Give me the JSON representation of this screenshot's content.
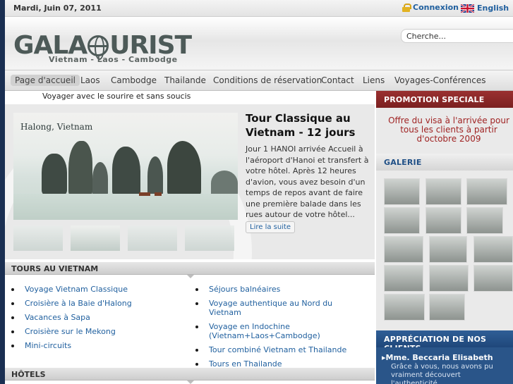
{
  "topbar": {
    "date": "Mardi, Juin 07, 2011",
    "login_label": "Connexion",
    "language_label": "English"
  },
  "header": {
    "logo_text_left": "GALA",
    "logo_text_right": "URIST",
    "tagline": "Vietnam - Laos - Cambodge",
    "search_placeholder": "Cherche..."
  },
  "nav": {
    "items": [
      "Page d'accueil",
      "Laos",
      "Cambodge",
      "Thailande",
      "Conditions de réservation",
      "Contact",
      "Liens",
      "Voyages-Conférences"
    ]
  },
  "slogan": "Voyager avec le sourire et sans soucis",
  "feature": {
    "photo_caption": "Halong, Vietnam",
    "title": "Tour Classique au Vietnam - 12 jours",
    "text": "Jour 1   HANOI arrivée Accueil à l'aéroport d'Hanoi et transfert à votre hôtel. Après 12 heures d'avion, vous avez besoin d'un temps de repos avant de faire une première balade dans les rues autour de votre hôtel...",
    "read_more": "Lire la suite"
  },
  "tours": {
    "heading": "TOURS AU VIETNAM",
    "left": [
      "Voyage Vietnam Classique",
      "Croisière à la Baie d'Halong",
      "Vacances à Sapa",
      "Croisière sur le Mekong",
      "Mini-circuits"
    ],
    "right": [
      "Séjours balnéaires",
      "Voyage authentique au Nord du Vietnam",
      "Voyage en Indochine (Vietnam+Laos+Cambodge)",
      "Tour combiné Vietnam et Thailande",
      "Tours en Thailande"
    ]
  },
  "hotels": {
    "heading": "HÔTELS"
  },
  "sidebar": {
    "promo_heading": "PROMOTION SPECIALE",
    "promo_text": "Offre du visa à l'arrivée pour tous les clients à partir d'octobre 2009",
    "gallery_heading": "GALERIE",
    "appreciation_heading": "APPRÉCIATION DE NOS CLIENTS",
    "appreciation_name": "Mme. Beccaria Elisabeth",
    "appreciation_quote": "Grâce à vous, nous avons pu vraiment découvert l'authenticité..."
  },
  "colors": {
    "accent_blue": "#1f5f9e",
    "promo_red": "#8a2828",
    "appreciation_blue": "#2a5589"
  }
}
